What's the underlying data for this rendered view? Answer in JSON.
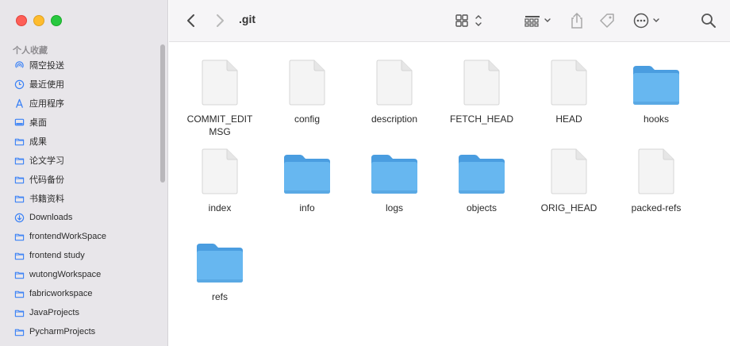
{
  "window": {
    "title": ".git"
  },
  "sidebar": {
    "section_title": "个人收藏",
    "items": [
      {
        "label": "隔空投送",
        "icon": "airdrop-icon"
      },
      {
        "label": "最近使用",
        "icon": "clock-icon"
      },
      {
        "label": "应用程序",
        "icon": "applications-icon"
      },
      {
        "label": "桌面",
        "icon": "desktop-icon"
      },
      {
        "label": "成果",
        "icon": "folder-icon"
      },
      {
        "label": "论文学习",
        "icon": "folder-icon"
      },
      {
        "label": "代码备份",
        "icon": "folder-icon"
      },
      {
        "label": "书籍资料",
        "icon": "folder-icon"
      },
      {
        "label": "Downloads",
        "icon": "download-icon"
      },
      {
        "label": "frontendWorkSpace",
        "icon": "folder-icon"
      },
      {
        "label": "frontend study",
        "icon": "folder-icon"
      },
      {
        "label": "wutongWorkspace",
        "icon": "folder-icon"
      },
      {
        "label": "fabricworkspace",
        "icon": "folder-icon"
      },
      {
        "label": "JavaProjects",
        "icon": "folder-icon"
      },
      {
        "label": "PycharmProjects",
        "icon": "folder-icon"
      }
    ]
  },
  "files": [
    {
      "name": "COMMIT_EDITMSG",
      "kind": "document"
    },
    {
      "name": "config",
      "kind": "document"
    },
    {
      "name": "description",
      "kind": "document"
    },
    {
      "name": "FETCH_HEAD",
      "kind": "document"
    },
    {
      "name": "HEAD",
      "kind": "document"
    },
    {
      "name": "hooks",
      "kind": "folder"
    },
    {
      "name": "index",
      "kind": "document"
    },
    {
      "name": "info",
      "kind": "folder"
    },
    {
      "name": "logs",
      "kind": "folder"
    },
    {
      "name": "objects",
      "kind": "folder"
    },
    {
      "name": "ORIG_HEAD",
      "kind": "document"
    },
    {
      "name": "packed-refs",
      "kind": "document"
    },
    {
      "name": "refs",
      "kind": "folder"
    }
  ],
  "colors": {
    "folder_body": "#67b7f0",
    "folder_tab": "#4a9de0",
    "sidebar_icon": "#3b82f6"
  }
}
